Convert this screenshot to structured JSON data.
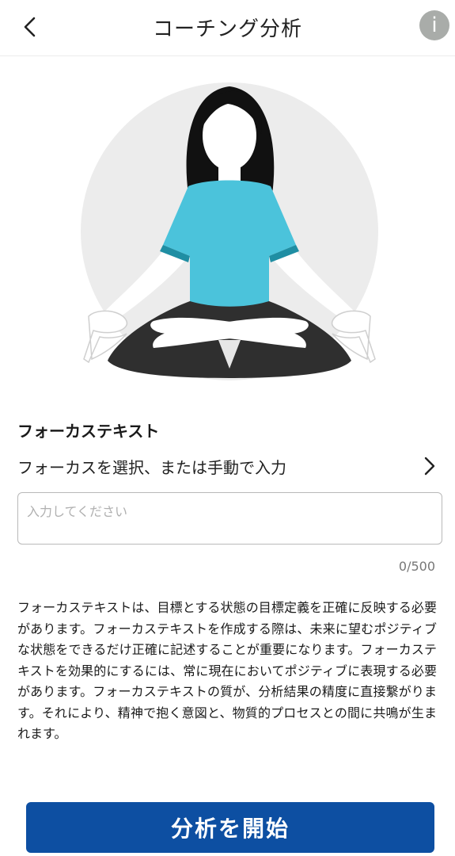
{
  "header": {
    "title": "コーチング分析",
    "info_label": "i"
  },
  "focus": {
    "section_title": "フォーカステキスト",
    "select_label": "フォーカスを選択、または手動で入力",
    "input_placeholder": "入力してください",
    "input_value": "",
    "char_count": "0/500"
  },
  "description": "フォーカステキストは、目標とする状態の目標定義を正確に反映する必要があります。フォーカステキストを作成する際は、未来に望むポジティブな状態をできるだけ正確に記述することが重要になります。フォーカステキストを効果的にするには、常に現在においてポジティブに表現する必要があります。フォーカステキストの質が、分析結果の精度に直接繋がります。それにより、精神で抱く意図と、物質的プロセスとの間に共鳴が生まれます。",
  "start_button": {
    "label": "分析を開始"
  },
  "colors": {
    "primary": "#0d4fa2",
    "info_badge": "#a9aca9",
    "shirt": "#4bc3db",
    "hair": "#111111",
    "pants": "#2f2f2f",
    "backdrop": "#ececec"
  },
  "icons": {
    "back": "chevron-left-icon",
    "info": "info-icon",
    "select": "chevron-right-icon"
  }
}
